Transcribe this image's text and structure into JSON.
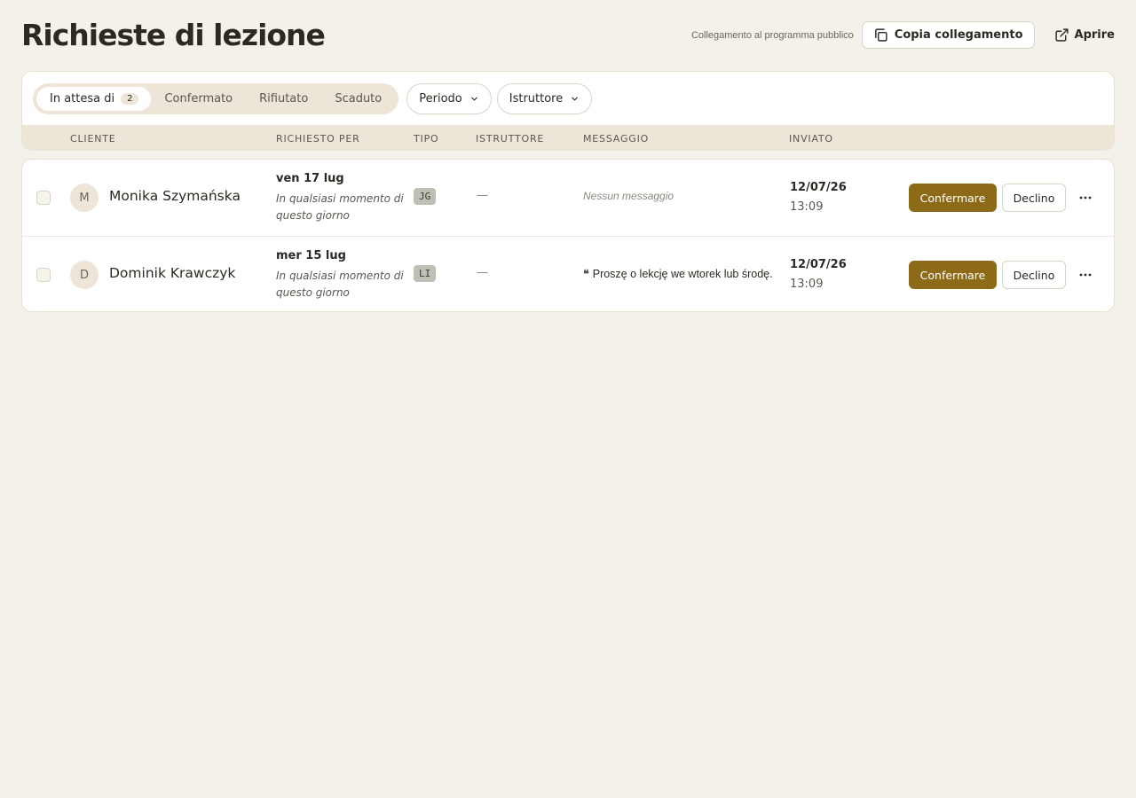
{
  "page": {
    "title": "Richieste di lezione"
  },
  "header": {
    "link_caption": "Collegamento al programma pubblico",
    "copy_label": "Copia collegamento",
    "open_label": "Aprire",
    "copy_icon": "copy-icon",
    "open_icon": "external-link-icon"
  },
  "tabs": [
    {
      "label": "In attesa di",
      "count": "2",
      "active": true
    },
    {
      "label": "Confermato"
    },
    {
      "label": "Rifiutato"
    },
    {
      "label": "Scaduto"
    }
  ],
  "filters": [
    {
      "label": "Periodo"
    },
    {
      "label": "Istruttore"
    }
  ],
  "columns": {
    "client": "CLIENTE",
    "requested": "RICHIESTO PER",
    "type": "TIPO",
    "instructor": "ISTRUTTORE",
    "message": "MESSAGGIO",
    "sent": "INVIATO"
  },
  "rows": [
    {
      "initial": "M",
      "name": "Monika Szymańska",
      "requested_date": "ven 17 lug",
      "requested_note": "In qualsiasi momento di questo giorno",
      "type": "JG",
      "instructor": "—",
      "message": "Nessun messaggio",
      "sent_date": "12/07/26",
      "sent_time": "13:09",
      "confirm_label": "Confermare",
      "decline_label": "Declino"
    },
    {
      "initial": "D",
      "name": "Dominik Krawczyk",
      "requested_date": "mer 15 lug",
      "requested_note": "In qualsiasi momento di questo giorno",
      "type": "LI",
      "instructor": "—",
      "message_quote": "❝",
      "message": "Proszę o lekcję we wtorek lub środę.",
      "sent_date": "12/07/26",
      "sent_time": "13:09",
      "confirm_label": "Confermare",
      "decline_label": "Declino"
    }
  ],
  "colors": {
    "accent": "#8d6a17",
    "background": "#f4f1ea",
    "header_band": "#ede5d8"
  }
}
